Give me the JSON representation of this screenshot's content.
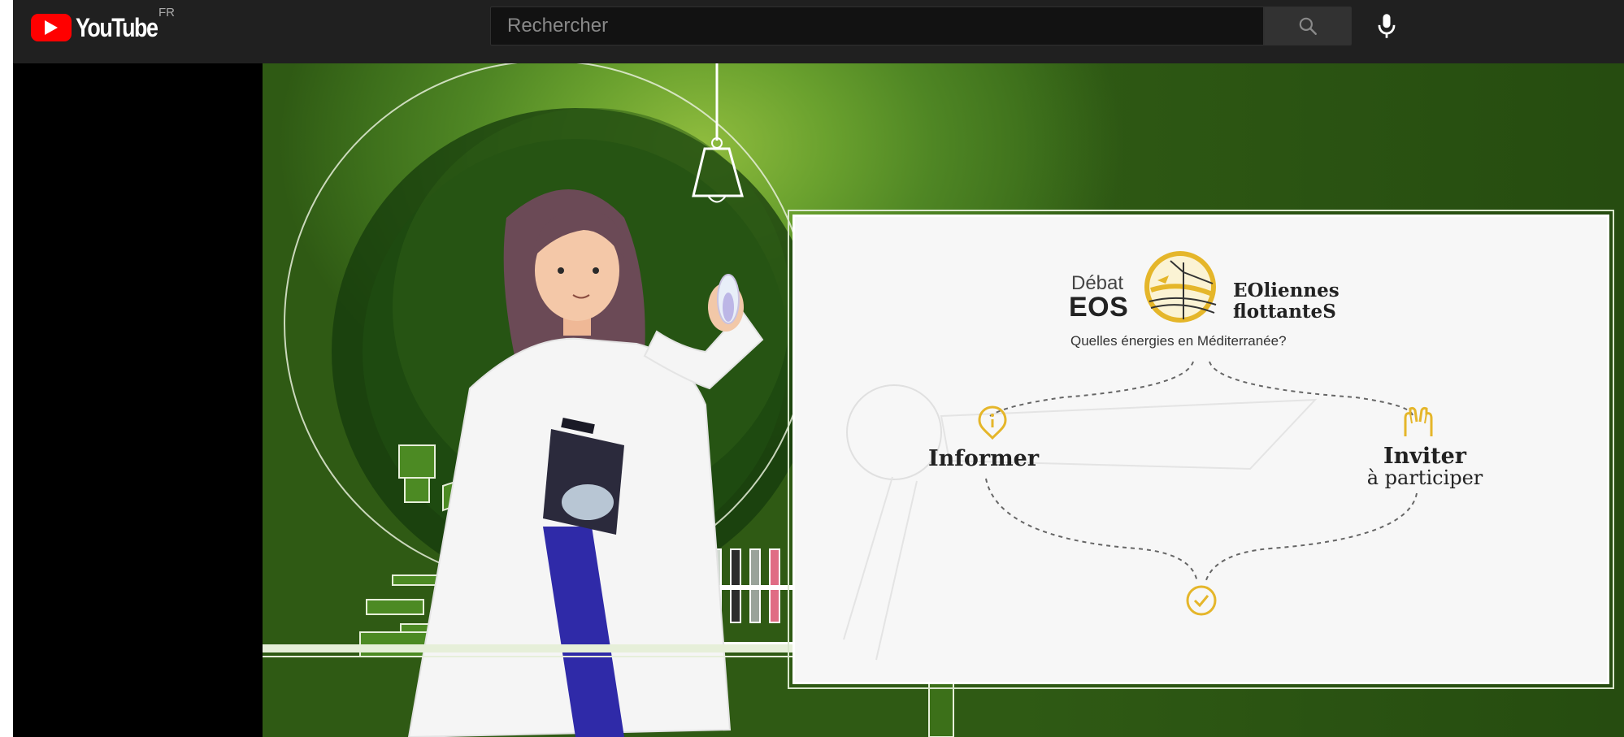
{
  "browser": {
    "tab_strip": "tabs"
  },
  "youtube": {
    "logo_wordmark": "YouTube",
    "country_code": "FR",
    "search_placeholder": "Rechercher",
    "search_value": "",
    "icons": [
      "youtube-play-icon",
      "search-icon",
      "microphone-icon"
    ]
  },
  "video": {
    "board": {
      "debat": "Débat",
      "eos": "EOS",
      "eoliennes_line1": "EOliennes",
      "eoliennes_line2": "flottanteS",
      "subtitle": "Quelles énergies en Méditerranée?",
      "step_left": "Informer",
      "step_right_line1": "Inviter",
      "step_right_line2": "à participer",
      "icons": [
        "info-icon",
        "raised-hands-icon",
        "check-circle-icon"
      ]
    },
    "colors": {
      "accent_gold": "#e5b62a",
      "background_green": "#4f8624",
      "board": "#f7f7f7"
    }
  }
}
